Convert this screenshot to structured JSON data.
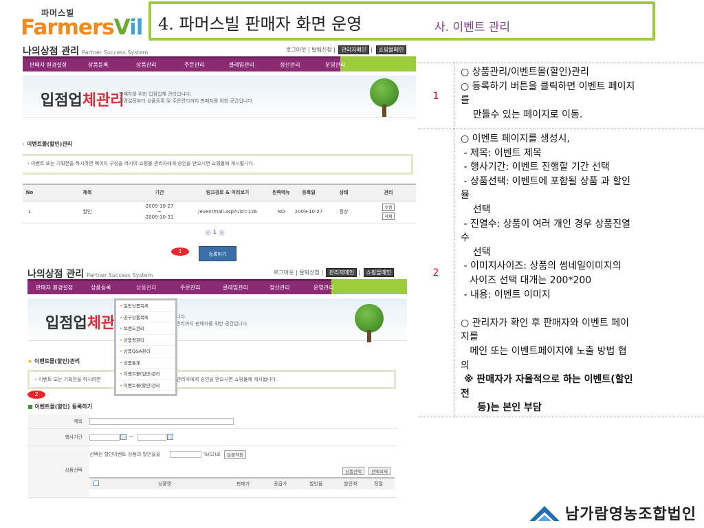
{
  "header": {
    "logo_kr": "파머스빌",
    "logo_en_1": "Farmers",
    "logo_en_2": "V",
    "logo_en_3": "il",
    "title": "4. 파머스빌 판매자 화면 운영",
    "subtitle": "사. 이벤트 관리"
  },
  "shot1": {
    "brand": "나의상점 관리",
    "brand_en": "Partner Success System",
    "toplinks": [
      "로그아웃",
      "탈퇴신청",
      "관리자메인",
      "쇼핑몰메인"
    ],
    "menu": [
      "판매자 환경설정",
      "상품등록",
      "상품관리",
      "주문관리",
      "클레임관리",
      "정산관리",
      "운영관리"
    ],
    "banner_big_1": "입점업",
    "banner_big_2": "체관리",
    "banner_small_1": "판매자를 위한 입점업체 관리입니다.",
    "banner_small_2": "환경설정부터 상품등록 및 주문관리까지 판매자를 위한 공간입니다.",
    "section_title": "이벤트몰(할인)관리",
    "notice": "이벤트 또는 기획전을 하시려면 페이지 구성을 하시여 쇼핑몰 관리자에게 승인을 받으시면 쇼핑몰에 게시됩니다.",
    "table": {
      "headers": [
        "No",
        "제목",
        "기간",
        "링크경로 & 미리보기",
        "왼쪽메뉴",
        "등록일",
        "상태",
        "관리"
      ],
      "rows": [
        {
          "no": "1",
          "title": "할인",
          "period_start": "2009-10-27",
          "period_sep": "~",
          "period_end": "2009-10-31",
          "link": "/eventmall.asp?uid=126",
          "left_menu": "NO",
          "reg_date": "2009-10-27",
          "status": "정상",
          "edit": "수정",
          "delete": "삭제"
        }
      ]
    },
    "pager": "1",
    "register_button": "등록하기",
    "marker": "1"
  },
  "shot2": {
    "brand": "나의상점 관리",
    "brand_en": "Partner Success System",
    "toplinks": [
      "로그아웃",
      "탈퇴신청",
      "관리자메인",
      "쇼핑몰메인"
    ],
    "menu": [
      "판매자 환경설정",
      "상품등록",
      "상품관리",
      "주문관리",
      "클레임관리",
      "정산관리",
      "운영관리"
    ],
    "banner_big_1": "입점업",
    "banner_big_2": "체관리",
    "banner_small_1": "니다.",
    "banner_small_2": "관리까지 판매자를 위한 공간입니다.",
    "dropdown": [
      "일반상품목록",
      "공구상품목록",
      "브랜드관리",
      "상품평관리",
      "상품Q&A관리",
      "상품통계",
      "이벤트몰(일반)관리",
      "이벤트몰(할인)관리"
    ],
    "section_title": "이벤트몰(할인)관리",
    "notice_left": "이벤트 또는 기획전을 하시려면",
    "notice_right": "관리자에게 승인을 받으시면 쇼핑몰에 게시됩니다.",
    "marker": "2",
    "form_title": "이벤트몰(할인) 등록하기",
    "form": {
      "title_label": "제목",
      "period_label": "행사기간",
      "period_sep": "~",
      "product_label": "상품선택",
      "discount_text_1": "선택된 할인이벤트 상품의 할인율을",
      "discount_text_2": "%(으)로",
      "apply_button": "일괄적용",
      "select_button": "상품선택",
      "delete_button": "선택삭제",
      "columns": [
        "상품명",
        "판매가",
        "공급가",
        "할인율",
        "할인액",
        "정렬"
      ]
    }
  },
  "desc": {
    "row1_num": "1",
    "row1_lines": [
      "○ 상품관리/이벤트몰(할인)관리",
      "○ 등록하기 버튼을 클릭하면 이벤트 페이지",
      "를",
      "    만들수 있는 페이지로 이동."
    ],
    "row2_num": "2",
    "row2_lines": [
      "○ 이벤트 페이지를 생성시,",
      " - 제목: 이벤트 제목",
      " - 행사기간: 이벤트 진행할 기간 선택",
      " - 상품선택: 이벤트에 포함될 상품 과 할인",
      "율",
      "    선택",
      " - 진열수: 상품이 여러 개인 경우 상품진열",
      "수",
      "    선택",
      " - 이미지사이즈: 상품의 썸네일이미지의",
      "   사이즈 선택 대개는 200*200",
      " - 내용: 이벤트 이미지",
      "",
      "○ 관리자가 확인 후 판매자와 이벤트 페이",
      "지를",
      "   메인 또는 이벤트페이지에 노출 방법 협",
      "의"
    ],
    "row2_bold_lines": [
      " ※ 판매자가 자율적으로 하는 이벤트(할인",
      "전",
      "     등)는 본인 부담"
    ]
  },
  "footer": {
    "org_name": "남가람영농조합법인"
  },
  "colors": {
    "accent_green": "#9ccb3c",
    "menu_purple": "#8a2b73",
    "marker_red": "#e8262b",
    "number_red": "#e0001b",
    "subtitle_purple": "#7a3d8a"
  }
}
